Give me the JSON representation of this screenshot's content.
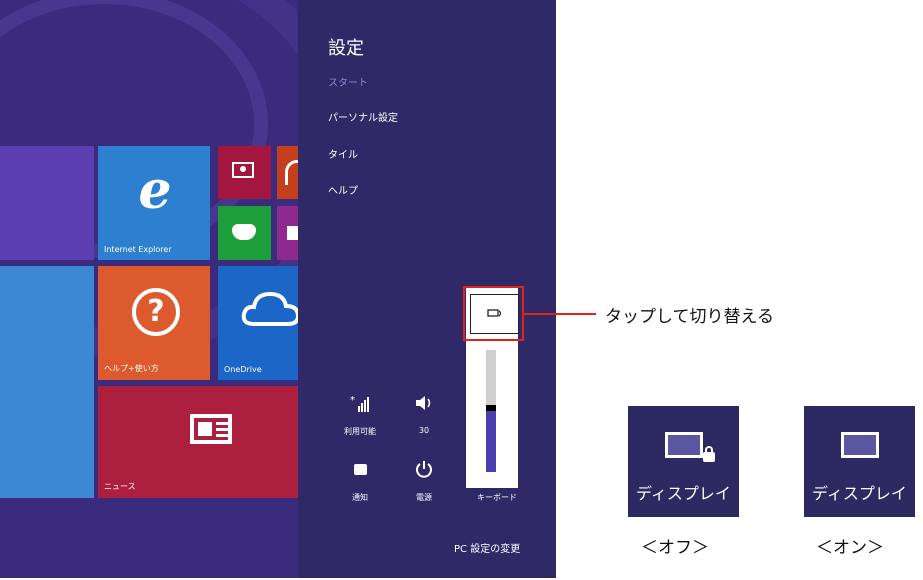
{
  "colors": {
    "start_bg": "#3b2b7c",
    "charm_bg": "#2f2a67",
    "ie_tile": "#2d7fd0",
    "help_tile": "#dc5a2e",
    "news_tile": "#ad1f3f",
    "onedrive_tile": "#1c66c8",
    "video_tile": "#a3163f",
    "games_tile": "#1e9e3b",
    "highlight": "#e2231a"
  },
  "start": {
    "tiles": {
      "ie": "Internet Explorer",
      "help": "ヘルプ+使い方",
      "onedrive": "OneDrive",
      "news": "ニュース"
    }
  },
  "settings": {
    "title": "設定",
    "items": [
      "スタート",
      "パーソナル設定",
      "タイル",
      "ヘルプ"
    ],
    "quick": {
      "network": "利用可能",
      "volume": "30",
      "notifications": "通知",
      "power": "電源",
      "keyboard": "キーボード"
    },
    "pc_settings": "PC 設定の変更",
    "brightness_level": 0.5
  },
  "annotation": {
    "text": "タップして切り替える"
  },
  "display_examples": [
    {
      "label": "ディスプレイ",
      "caption": "＜オフ＞",
      "locked": true
    },
    {
      "label": "ディスプレイ",
      "caption": "＜オン＞",
      "locked": false
    }
  ]
}
